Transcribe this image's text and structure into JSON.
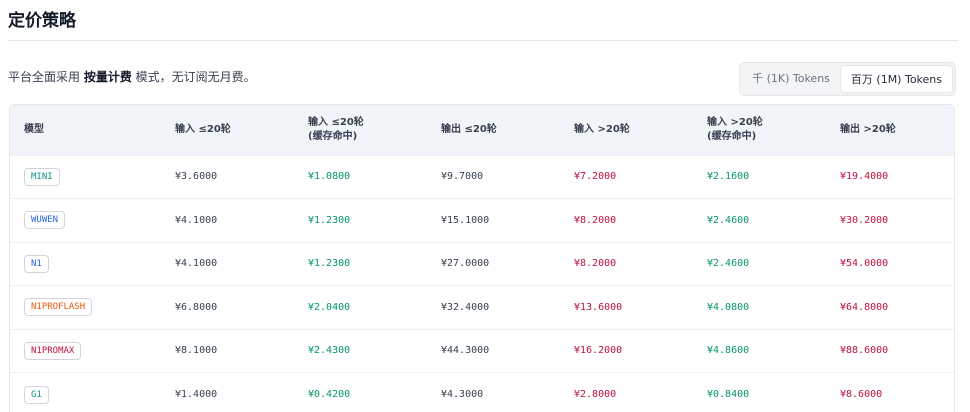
{
  "page": {
    "title": "定价策略",
    "intro_prefix": "平台全面采用 ",
    "intro_bold": "按量计费",
    "intro_suffix": " 模式，无订阅无月费。"
  },
  "unit_toggle": {
    "options": [
      "千 (1K) Tokens",
      "百万 (1M) Tokens"
    ],
    "selected": "百万 (1M) Tokens"
  },
  "table": {
    "headers": [
      "模型",
      "输入 ≤20轮",
      "输入 ≤20轮\n(缓存命中)",
      "输出 ≤20轮",
      "输入 >20轮",
      "输入 >20轮\n(缓存命中)",
      "输出 >20轮"
    ],
    "rows": [
      {
        "model": "MINI",
        "model_color": "#0d9488",
        "values": [
          "¥3.6000",
          "¥1.0800",
          "¥9.7000",
          "¥7.2000",
          "¥2.1600",
          "¥19.4000"
        ]
      },
      {
        "model": "WUWEN",
        "model_color": "#2563eb",
        "values": [
          "¥4.1000",
          "¥1.2300",
          "¥15.1000",
          "¥8.2000",
          "¥2.4600",
          "¥30.2000"
        ]
      },
      {
        "model": "N1",
        "model_color": "#2563eb",
        "values": [
          "¥4.1000",
          "¥1.2300",
          "¥27.0000",
          "¥8.2000",
          "¥2.4600",
          "¥54.0000"
        ]
      },
      {
        "model": "N1PROFLASH",
        "model_color": "#ea580c",
        "values": [
          "¥6.8000",
          "¥2.0400",
          "¥32.4000",
          "¥13.6000",
          "¥4.0800",
          "¥64.8000"
        ]
      },
      {
        "model": "N1PROMAX",
        "model_color": "#be123c",
        "values": [
          "¥8.1000",
          "¥2.4300",
          "¥44.3000",
          "¥16.2000",
          "¥4.8600",
          "¥88.6000"
        ]
      },
      {
        "model": "G1",
        "model_color": "#0d9488",
        "values": [
          "¥1.4000",
          "¥0.4200",
          "¥4.3000",
          "¥2.8000",
          "¥0.8400",
          "¥8.6000"
        ]
      }
    ]
  },
  "colors": {
    "cached_price": "#059669",
    "over_20_price": "#be123c",
    "base_price": "#374151"
  }
}
